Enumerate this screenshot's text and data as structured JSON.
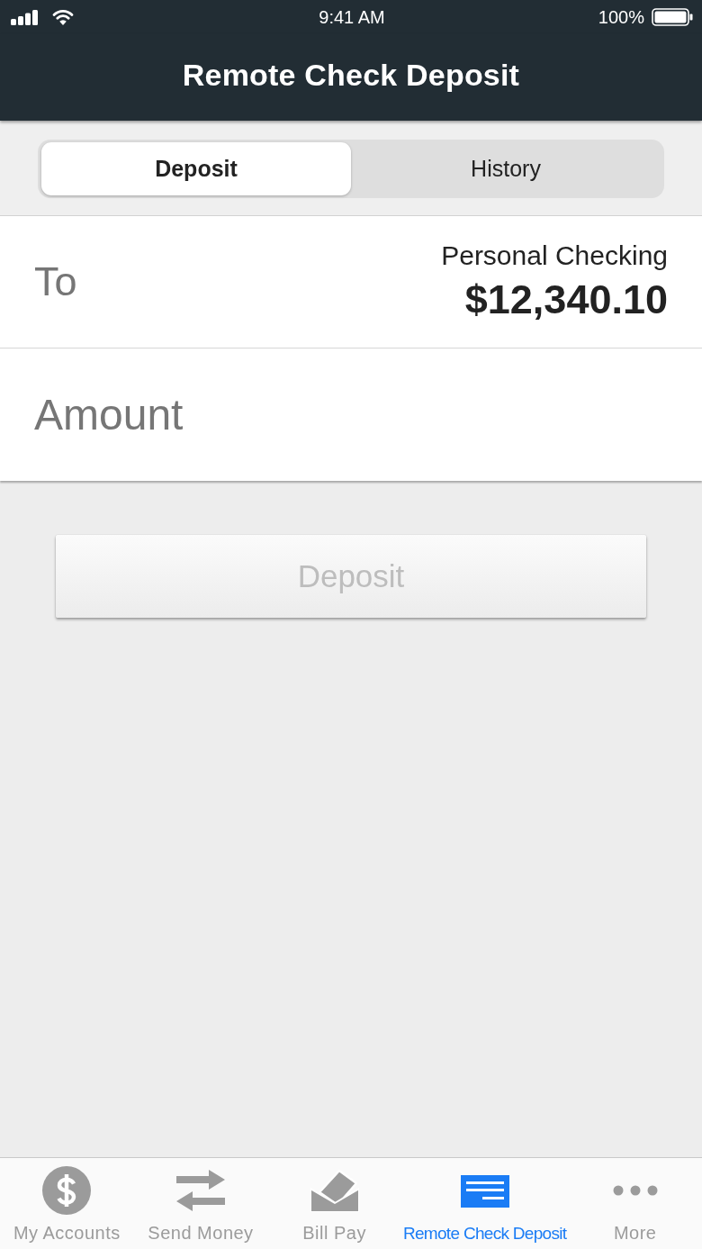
{
  "status_bar": {
    "time": "9:41 AM",
    "battery": "100%"
  },
  "nav_bar": {
    "title": "Remote Check Deposit"
  },
  "segments": [
    {
      "label": "Deposit",
      "selected": true
    },
    {
      "label": "History",
      "selected": false
    }
  ],
  "form": {
    "to": {
      "label": "To",
      "account_name": "Personal Checking",
      "balance": "$12,340.10"
    },
    "amount": {
      "placeholder": "Amount"
    }
  },
  "deposit_button": {
    "label": "Deposit",
    "disabled": true
  },
  "tab_bar": [
    {
      "label": "My Accounts",
      "selected": false
    },
    {
      "label": "Send Money",
      "selected": false
    },
    {
      "label": "Bill Pay",
      "selected": false
    },
    {
      "label": "Remote Check Deposit",
      "selected": true
    },
    {
      "label": "More",
      "selected": false
    }
  ]
}
